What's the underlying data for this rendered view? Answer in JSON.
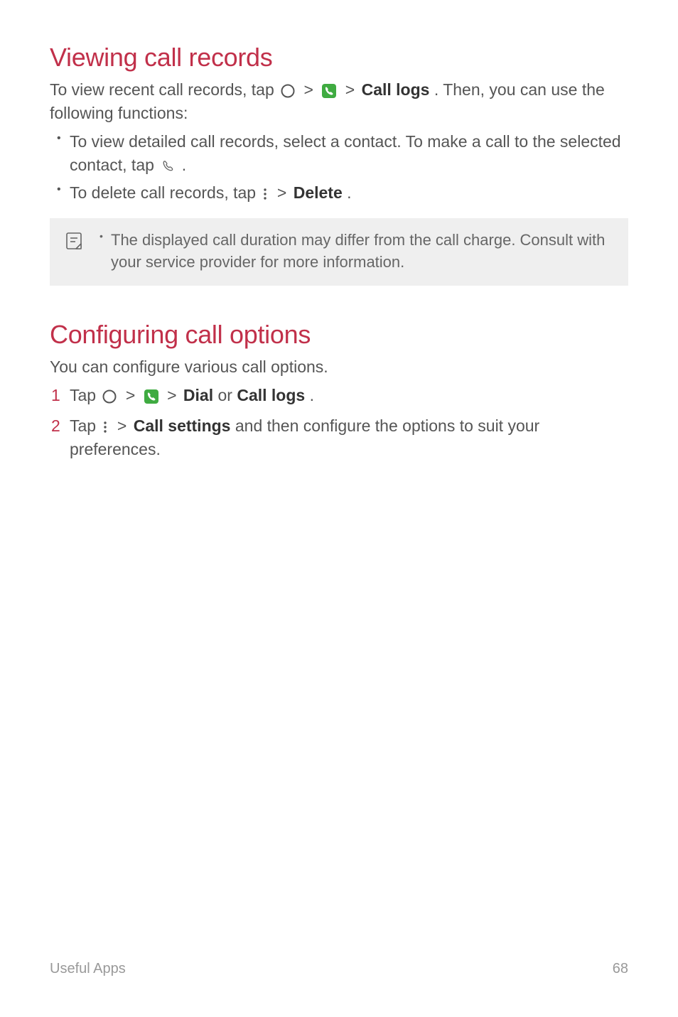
{
  "section1": {
    "heading": "Viewing call records",
    "intro_pre": "To view recent call records, tap ",
    "intro_mid_sep1": ">",
    "intro_mid_sep2": ">",
    "intro_bold": "Call logs",
    "intro_post": ". Then, you can use the following functions:",
    "bullets": [
      {
        "pre": "To view detailed call records, select a contact. To make a call to the selected contact, tap ",
        "post": "."
      },
      {
        "pre": "To delete call records, tap ",
        "sep": ">",
        "bold": "Delete",
        "post": "."
      }
    ],
    "note": "The displayed call duration may differ from the call charge. Consult with your service provider for more information."
  },
  "section2": {
    "heading": "Configuring call options",
    "intro": "You can configure various call options.",
    "steps": [
      {
        "pre": "Tap ",
        "sep1": ">",
        "sep2": ">",
        "bold1": "Dial",
        "mid": " or ",
        "bold2": "Call logs",
        "post": "."
      },
      {
        "pre": "Tap ",
        "sep": ">",
        "bold": "Call settings",
        "post": " and then configure the options to suit your preferences."
      }
    ]
  },
  "footer": {
    "section_label": "Useful Apps",
    "page_number": "68"
  }
}
